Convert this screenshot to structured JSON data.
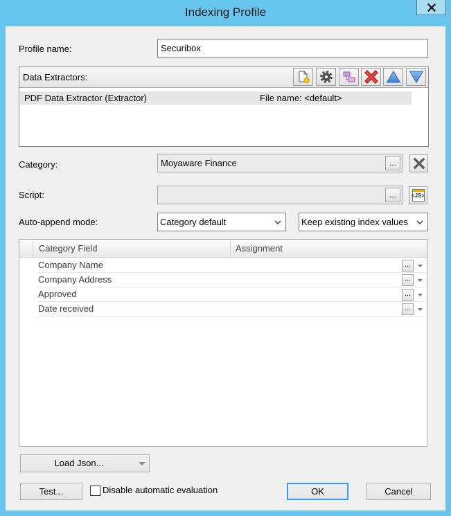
{
  "window": {
    "title": "Indexing Profile"
  },
  "profile_name": {
    "label": "Profile name:",
    "value": "Securibox"
  },
  "data_extractors": {
    "label": "Data Extractors:",
    "toolbar_icons": [
      "new-document-icon",
      "gear-icon",
      "mapping-icon",
      "delete-icon",
      "arrow-up-icon",
      "arrow-down-icon"
    ],
    "items": [
      {
        "name": "PDF Data Extractor (Extractor)",
        "file": "File name: <default>"
      }
    ]
  },
  "category": {
    "label": "Category:",
    "value": "Moyaware Finance",
    "browse_label": "..."
  },
  "script": {
    "label": "Script:",
    "value": "",
    "browse_label": "...",
    "js_icon_text": "<JS>"
  },
  "auto_append": {
    "label": "Auto-append mode:",
    "mode": "Category default",
    "existing_values": "Keep existing index values"
  },
  "grid": {
    "columns": [
      "Category Field",
      "Assignment"
    ],
    "browse_label": "...",
    "rows": [
      {
        "field": "Company Name",
        "assignment": ""
      },
      {
        "field": "Company Address",
        "assignment": ""
      },
      {
        "field": "Approved",
        "assignment": ""
      },
      {
        "field": "Date received",
        "assignment": ""
      }
    ]
  },
  "footer": {
    "load_json_label": "Load Json...",
    "test_label": "Test...",
    "disable_evaluation_label": "Disable automatic evaluation",
    "disable_evaluation_checked": false,
    "ok_label": "OK",
    "cancel_label": "Cancel"
  },
  "colors": {
    "frame": "#68c5ed",
    "default_button_border": "#3399ff"
  }
}
